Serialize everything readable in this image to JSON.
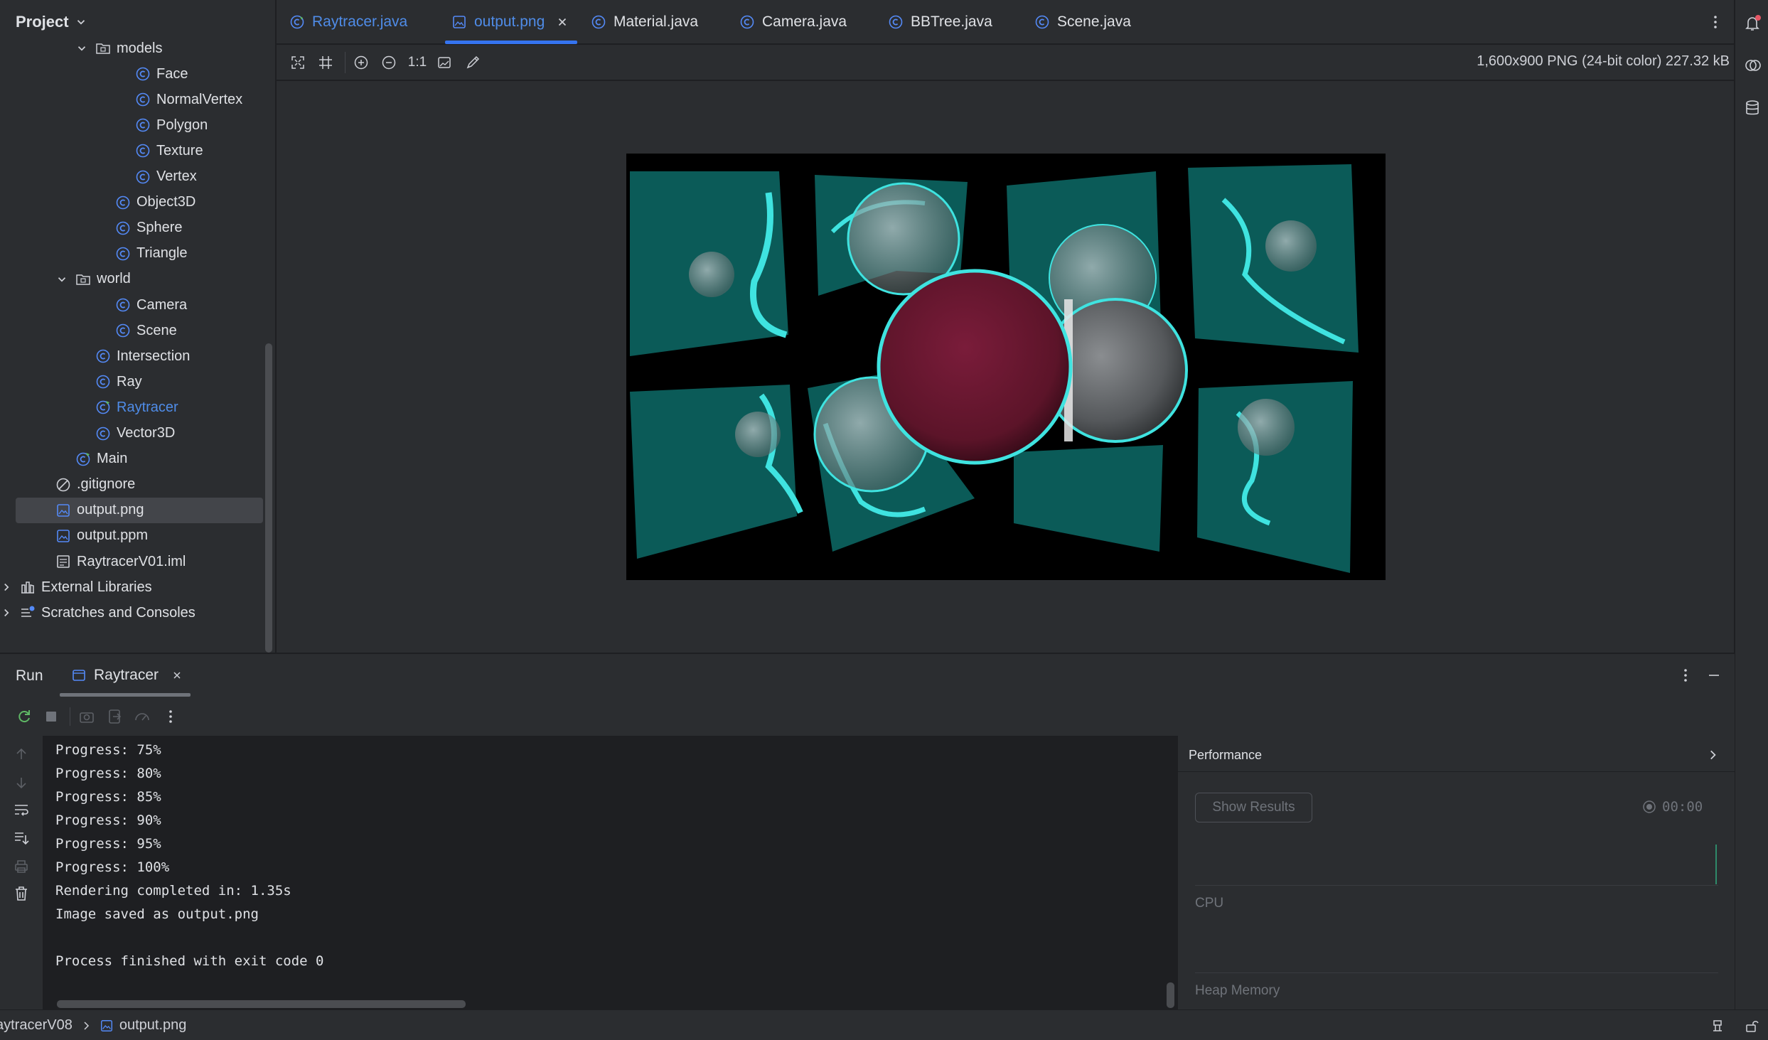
{
  "project": {
    "title": "Project",
    "tree": [
      {
        "label": "models",
        "kind": "folder",
        "expanded": true,
        "depth": 5
      },
      {
        "label": "Face",
        "kind": "class",
        "depth": 7
      },
      {
        "label": "NormalVertex",
        "kind": "class",
        "depth": 7
      },
      {
        "label": "Polygon",
        "kind": "class",
        "depth": 7
      },
      {
        "label": "Texture",
        "kind": "class",
        "depth": 7
      },
      {
        "label": "Vertex",
        "kind": "class",
        "depth": 7
      },
      {
        "label": "Object3D",
        "kind": "class",
        "depth": 6
      },
      {
        "label": "Sphere",
        "kind": "class",
        "depth": 6
      },
      {
        "label": "Triangle",
        "kind": "class",
        "depth": 6
      },
      {
        "label": "world",
        "kind": "folder",
        "expanded": true,
        "depth": 4
      },
      {
        "label": "Camera",
        "kind": "class",
        "depth": 6
      },
      {
        "label": "Scene",
        "kind": "class",
        "depth": 6
      },
      {
        "label": "Intersection",
        "kind": "class",
        "depth": 5
      },
      {
        "label": "Ray",
        "kind": "class",
        "depth": 5
      },
      {
        "label": "Raytracer",
        "kind": "main-class",
        "depth": 5,
        "highlight": true
      },
      {
        "label": "Vector3D",
        "kind": "class",
        "depth": 5
      },
      {
        "label": "Main",
        "kind": "main-class",
        "depth": 4
      },
      {
        "label": ".gitignore",
        "kind": "ignore",
        "depth": 3
      },
      {
        "label": "output.png",
        "kind": "image",
        "depth": 3,
        "selected": true
      },
      {
        "label": "output.ppm",
        "kind": "image",
        "depth": 3
      },
      {
        "label": "RaytracerV01.iml",
        "kind": "iml",
        "depth": 3
      },
      {
        "label": "External Libraries",
        "kind": "libraries",
        "depth": 1,
        "collapsed": true
      },
      {
        "label": "Scratches and Consoles",
        "kind": "scratches",
        "depth": 1,
        "collapsed": true
      }
    ]
  },
  "tabs": [
    {
      "label": "Raytracer.java",
      "icon": "main-class-icon"
    },
    {
      "label": "output.png",
      "icon": "image-file-icon",
      "active": true
    },
    {
      "label": "Material.java",
      "icon": "class-icon"
    },
    {
      "label": "Camera.java",
      "icon": "class-icon"
    },
    {
      "label": "BBTree.java",
      "icon": "class-icon"
    },
    {
      "label": "Scene.java",
      "icon": "class-icon"
    }
  ],
  "image_viewer": {
    "info": "1,600x900 PNG (24-bit color) 227.32 kB",
    "zoom_actual_label": "1:1"
  },
  "run": {
    "title": "Run",
    "tab_label": "Raytracer",
    "console_lines": [
      "Progress: 75%",
      "Progress: 80%",
      "Progress: 85%",
      "Progress: 90%",
      "Progress: 95%",
      "Progress: 100%",
      "Rendering completed in: 1.35s",
      "Image saved as output.png",
      "",
      "Process finished with exit code 0"
    ]
  },
  "performance": {
    "title": "Performance",
    "show_results_label": "Show Results",
    "timer": "00:00",
    "cpu_label": "CPU",
    "heap_label": "Heap Memory"
  },
  "status": {
    "project_crumb": "aytracerV08",
    "file_crumb": "output.png"
  },
  "colors": {
    "accent": "#3574f0",
    "link_blue": "#4f8ce8",
    "panel_bg": "#2b2d30",
    "console_bg": "#1e1f22",
    "teal_panels": "#0a5a58",
    "cyan_highlight": "#3fe3e0",
    "maroon_sphere": "#6e1a34"
  }
}
